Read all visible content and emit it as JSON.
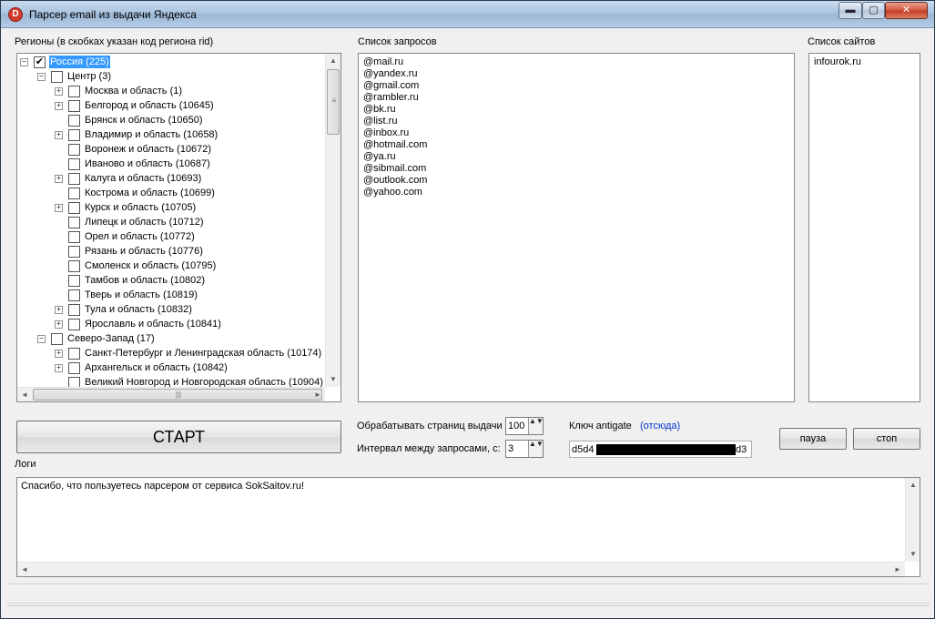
{
  "window": {
    "title": "Парсер email из выдачи Яндекса",
    "icon_letter": "D",
    "minimize_glyph": "▬",
    "maximize_glyph": "▢",
    "close_glyph": "✕"
  },
  "regions": {
    "label": "Регионы (в скобках указан код региона rid)",
    "items": [
      {
        "label": "Россия (225)",
        "level": 0,
        "toggle": "−",
        "checked": true,
        "selected": true
      },
      {
        "label": "Центр (3)",
        "level": 1,
        "toggle": "−",
        "checked": false,
        "selected": false
      },
      {
        "label": "Москва и область (1)",
        "level": 2,
        "toggle": "+",
        "checked": false,
        "selected": false
      },
      {
        "label": "Белгород и область (10645)",
        "level": 2,
        "toggle": "+",
        "checked": false,
        "selected": false
      },
      {
        "label": "Брянск и область (10650)",
        "level": 2,
        "toggle": "",
        "checked": false,
        "selected": false
      },
      {
        "label": "Владимир и область (10658)",
        "level": 2,
        "toggle": "+",
        "checked": false,
        "selected": false
      },
      {
        "label": "Воронеж и область (10672)",
        "level": 2,
        "toggle": "",
        "checked": false,
        "selected": false
      },
      {
        "label": "Иваново и область (10687)",
        "level": 2,
        "toggle": "",
        "checked": false,
        "selected": false
      },
      {
        "label": "Калуга и область (10693)",
        "level": 2,
        "toggle": "+",
        "checked": false,
        "selected": false
      },
      {
        "label": "Кострома и область (10699)",
        "level": 2,
        "toggle": "",
        "checked": false,
        "selected": false
      },
      {
        "label": "Курск и область (10705)",
        "level": 2,
        "toggle": "+",
        "checked": false,
        "selected": false
      },
      {
        "label": "Липецк и область (10712)",
        "level": 2,
        "toggle": "",
        "checked": false,
        "selected": false
      },
      {
        "label": "Орел и область (10772)",
        "level": 2,
        "toggle": "",
        "checked": false,
        "selected": false
      },
      {
        "label": "Рязань и область (10776)",
        "level": 2,
        "toggle": "",
        "checked": false,
        "selected": false
      },
      {
        "label": "Смоленск и область (10795)",
        "level": 2,
        "toggle": "",
        "checked": false,
        "selected": false
      },
      {
        "label": "Тамбов и область (10802)",
        "level": 2,
        "toggle": "",
        "checked": false,
        "selected": false
      },
      {
        "label": "Тверь и область (10819)",
        "level": 2,
        "toggle": "",
        "checked": false,
        "selected": false
      },
      {
        "label": "Тула и область (10832)",
        "level": 2,
        "toggle": "+",
        "checked": false,
        "selected": false
      },
      {
        "label": "Ярославль и область (10841)",
        "level": 2,
        "toggle": "+",
        "checked": false,
        "selected": false
      },
      {
        "label": "Северо-Запад (17)",
        "level": 1,
        "toggle": "−",
        "checked": false,
        "selected": false
      },
      {
        "label": "Санкт-Петербург и Ленинградская область (10174)",
        "level": 2,
        "toggle": "+",
        "checked": false,
        "selected": false
      },
      {
        "label": "Архангельск и область (10842)",
        "level": 2,
        "toggle": "+",
        "checked": false,
        "selected": false
      },
      {
        "label": "Великий Новгород и Новгородская область (10904)",
        "level": 2,
        "toggle": "",
        "checked": false,
        "selected": false
      }
    ]
  },
  "queries": {
    "label": "Список запросов",
    "items": [
      "@mail.ru",
      "@yandex.ru",
      "@gmail.com",
      "@rambler.ru",
      "@bk.ru",
      "@list.ru",
      "@inbox.ru",
      "@hotmail.com",
      "@ya.ru",
      "@sibmail.com",
      "@outlook.com",
      "@yahoo.com"
    ]
  },
  "sites": {
    "label": "Список сайтов",
    "items": [
      "infourok.ru"
    ]
  },
  "controls": {
    "start_label": "СТАРТ",
    "pages_label": "Обрабатывать страниц выдачи",
    "pages_value": "100",
    "interval_label": "Интервал между запросами, с:",
    "interval_value": "3",
    "spin_glyph": "▲▼",
    "antigate_label": "Ключ antigate",
    "antigate_link": "(отсюда)",
    "antigate_key_prefix": "d5d4",
    "antigate_key_suffix": "d3",
    "pause_label": "пауза",
    "stop_label": "стоп"
  },
  "logs": {
    "label": "Логи",
    "text": "Спасибо, что пользуетесь парсером от сервиса SokSaitov.ru!"
  },
  "scroll": {
    "up": "▲",
    "down": "▼",
    "left": "◄",
    "right": "►",
    "grip_v": "≡",
    "grip_h": "|||"
  },
  "tree_scroll_position": 0.0,
  "colors": {
    "selection": "#3399ff",
    "link": "#0033cc",
    "close_button": "#c23a1f"
  }
}
